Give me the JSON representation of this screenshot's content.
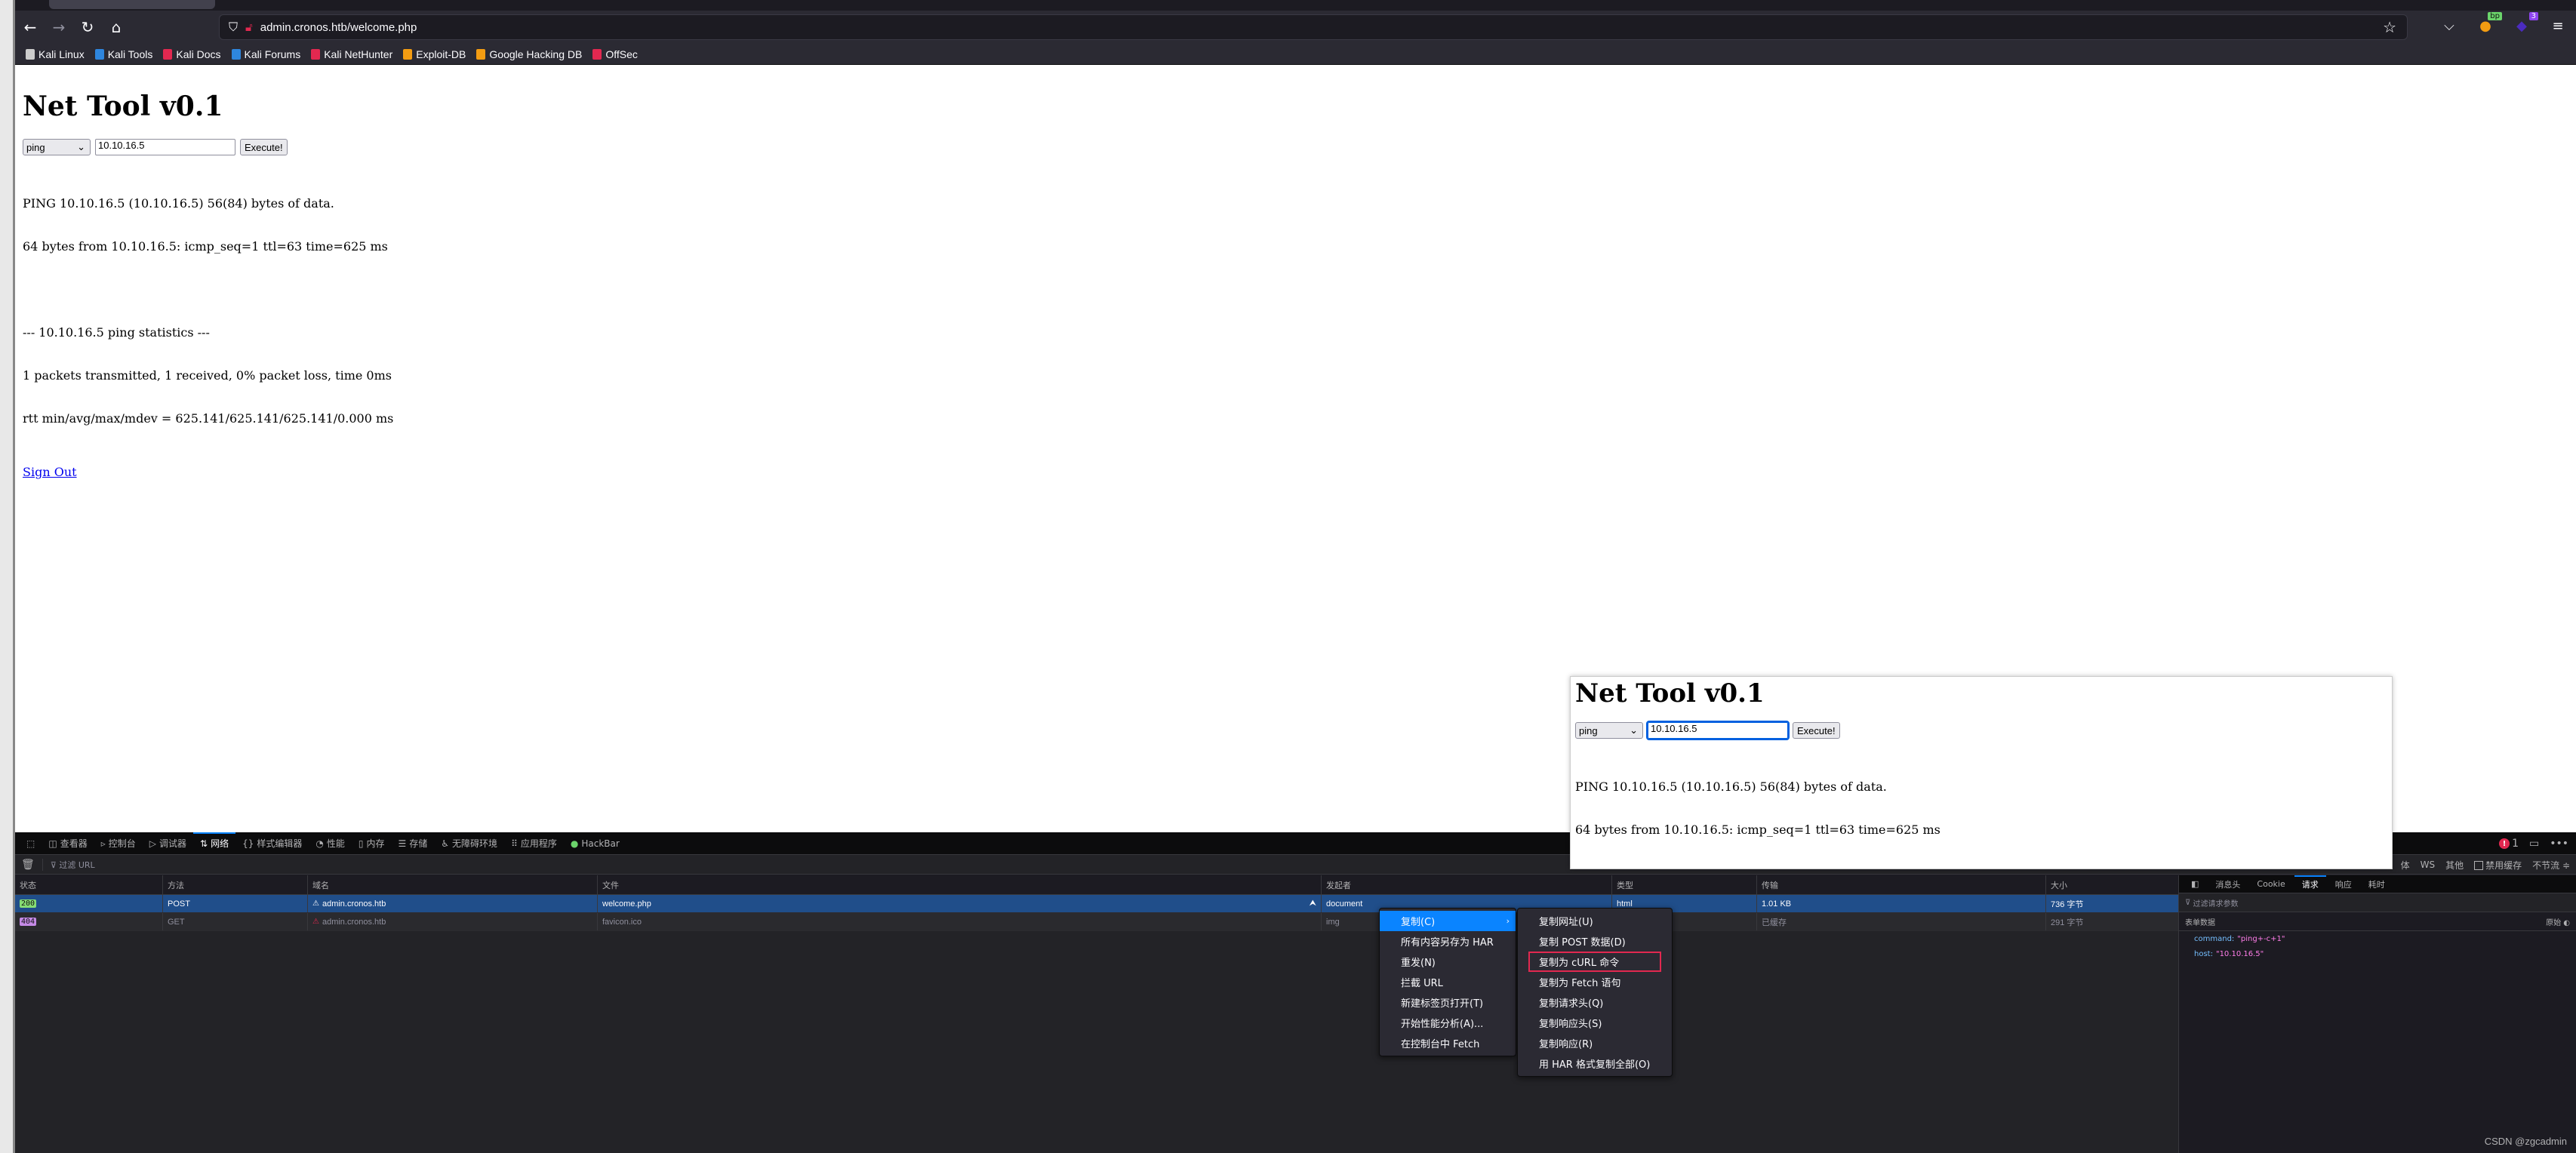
{
  "browser": {
    "url": "admin.cronos.htb/welcome.php",
    "bookmarks": [
      {
        "label": "Kali Linux",
        "color": "#cccccc"
      },
      {
        "label": "Kali Tools",
        "color": "#2e86de"
      },
      {
        "label": "Kali Docs",
        "color": "#e22850"
      },
      {
        "label": "Kali Forums",
        "color": "#2e86de"
      },
      {
        "label": "Kali NetHunter",
        "color": "#e22850"
      },
      {
        "label": "Exploit-DB",
        "color": "#f39c12"
      },
      {
        "label": "Google Hacking DB",
        "color": "#f39c12"
      },
      {
        "label": "OffSec",
        "color": "#e22850"
      }
    ],
    "extensions": [
      {
        "name": "pocket-icon",
        "badge": ""
      },
      {
        "name": "burp-proxy-icon",
        "badge": "bp",
        "badge_color": "#6bd46b"
      },
      {
        "name": "layers-icon",
        "badge": "3",
        "badge_color": "#8e44ef"
      }
    ]
  },
  "page": {
    "title": "Net Tool v0.1",
    "command_select": "ping",
    "host_input": "10.10.16.5",
    "execute_label": "Execute!",
    "output_lines": [
      "PING 10.10.16.5 (10.10.16.5) 56(84) bytes of data.",
      "64 bytes from 10.10.16.5: icmp_seq=1 ttl=63 time=625 ms",
      "",
      "--- 10.10.16.5 ping statistics ---",
      "1 packets transmitted, 1 received, 0% packet loss, time 0ms",
      "rtt min/avg/max/mdev = 625.141/625.141/625.141/0.000 ms"
    ],
    "sign_out": "Sign Out"
  },
  "devtools": {
    "tabs": [
      {
        "label": "查看器",
        "icon": "inspector-icon"
      },
      {
        "label": "控制台",
        "icon": "console-icon"
      },
      {
        "label": "调试器",
        "icon": "debugger-icon"
      },
      {
        "label": "网络",
        "icon": "network-icon",
        "active": true
      },
      {
        "label": "样式编辑器",
        "icon": "style-editor-icon"
      },
      {
        "label": "性能",
        "icon": "performance-icon"
      },
      {
        "label": "内存",
        "icon": "memory-icon"
      },
      {
        "label": "存储",
        "icon": "storage-icon"
      },
      {
        "label": "无障碍环境",
        "icon": "accessibility-icon"
      },
      {
        "label": "应用程序",
        "icon": "application-icon"
      },
      {
        "label": "HackBar",
        "icon": "hackbar-icon"
      }
    ],
    "error_count": "1",
    "filter_placeholder": "过滤 URL",
    "filter_types": [
      "体",
      "WS",
      "其他"
    ],
    "disable_cache": "禁用缓存",
    "throttle": "不节流 ≑",
    "columns": [
      "状态",
      "方法",
      "域名",
      "文件",
      "发起者",
      "类型",
      "传输",
      "大小"
    ],
    "rows": [
      {
        "status": "200",
        "status_color": "#86de74",
        "method": "POST",
        "domain": "admin.cronos.htb",
        "file": "welcome.php",
        "initiator": "document",
        "type": "html",
        "transfer": "1.01 KB",
        "size": "736 字节"
      },
      {
        "status": "404",
        "status_color": "#c58ae6",
        "method": "GET",
        "domain": "admin.cronos.htb",
        "file": "favicon.ico",
        "initiator": "img",
        "type": "",
        "transfer": "已缓存",
        "size": "291 字节"
      }
    ],
    "side_panel": {
      "tabs": [
        "消息头",
        "Cookie",
        "请求",
        "响应",
        "耗时"
      ],
      "active_tab": "请求",
      "filter_placeholder": "过滤请求参数",
      "section": "表单数据",
      "raw_label": "原始",
      "params": [
        {
          "key": "command:",
          "value": "\"ping+-c+1\""
        },
        {
          "key": "host:",
          "value": "\"10.10.16.5\""
        }
      ]
    },
    "watermark": "CSDN @zgcadmin"
  },
  "context_menu": {
    "main": [
      "复制(C)",
      "所有内容另存为 HAR",
      "重发(N)",
      "拦截 URL",
      "新建标签页打开(T)",
      "开始性能分析(A)...",
      "在控制台中 Fetch"
    ],
    "submenu": [
      "复制网址(U)",
      "复制 POST 数据(D)",
      "复制为 cURL 命令",
      "复制为 Fetch 语句",
      "复制请求头(Q)",
      "复制响应头(S)",
      "复制响应(R)",
      "用 HAR 格式复制全部(O)"
    ],
    "highlighted_submenu_item": "复制为 cURL 命令"
  }
}
